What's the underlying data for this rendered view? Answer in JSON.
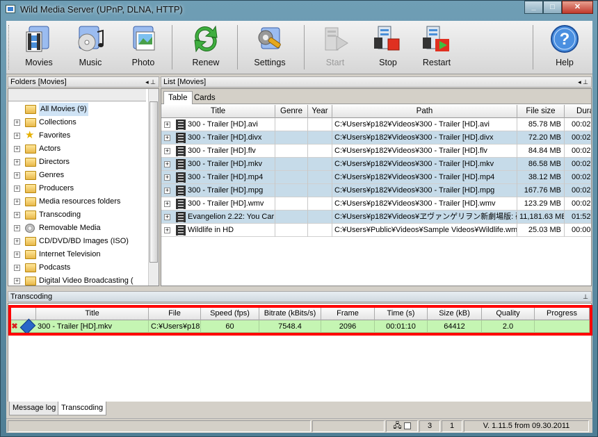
{
  "window": {
    "title": "Wild Media Server (UPnP, DLNA, HTTP)"
  },
  "toolbar": {
    "movies": "Movies",
    "music": "Music",
    "photo": "Photo",
    "renew": "Renew",
    "settings": "Settings",
    "start": "Start",
    "stop": "Stop",
    "restart": "Restart",
    "help": "Help"
  },
  "folders": {
    "header": "Folders [Movies]",
    "items": [
      "All Movies (9)",
      "Collections",
      "Favorites",
      "Actors",
      "Directors",
      "Genres",
      "Producers",
      "Media resources folders",
      "Transcoding",
      "Removable Media",
      "CD/DVD/BD Images (ISO)",
      "Internet Television",
      "Podcasts",
      "Digital Video Broadcasting ("
    ]
  },
  "list": {
    "header": "List [Movies]",
    "tabs": [
      "Table",
      "Cards"
    ],
    "columns": [
      "Title",
      "Genre",
      "Year",
      "Path",
      "File size",
      "Dura"
    ],
    "rows": [
      {
        "title": "300 - Trailer [HD].avi",
        "path": "C:¥Users¥p182¥Videos¥300 - Trailer [HD].avi",
        "size": "85.78 MB",
        "dur": "00:02:"
      },
      {
        "title": "300 - Trailer [HD].divx",
        "path": "C:¥Users¥p182¥Videos¥300 - Trailer [HD].divx",
        "size": "72.20 MB",
        "dur": "00:02:"
      },
      {
        "title": "300 - Trailer [HD].flv",
        "path": "C:¥Users¥p182¥Videos¥300 - Trailer [HD].flv",
        "size": "84.84 MB",
        "dur": "00:02:"
      },
      {
        "title": "300 - Trailer [HD].mkv",
        "path": "C:¥Users¥p182¥Videos¥300 - Trailer [HD].mkv",
        "size": "86.58 MB",
        "dur": "00:02:"
      },
      {
        "title": "300 - Trailer [HD].mp4",
        "path": "C:¥Users¥p182¥Videos¥300 - Trailer [HD].mp4",
        "size": "38.12 MB",
        "dur": "00:02:"
      },
      {
        "title": "300 - Trailer [HD].mpg",
        "path": "C:¥Users¥p182¥Videos¥300 - Trailer [HD].mpg",
        "size": "167.76 MB",
        "dur": "00:02:"
      },
      {
        "title": "300 - Trailer [HD].wmv",
        "path": "C:¥Users¥p182¥Videos¥300 - Trailer [HD].wmv",
        "size": "123.29 MB",
        "dur": "00:02:"
      },
      {
        "title": "Evangelion 2.22: You Car",
        "path": "C:¥Users¥p182¥Videos¥ヱヴァンゲリヲン新劇場版: 破.m",
        "size": "11,181.63 MB",
        "dur": "01:52:"
      },
      {
        "title": "Wildlife in HD",
        "path": "C:¥Users¥Public¥Videos¥Sample Videos¥Wildlife.wmv",
        "size": "25.03 MB",
        "dur": "00:00:"
      }
    ]
  },
  "transcoding": {
    "header": "Transcoding",
    "columns": [
      "Title",
      "File",
      "Speed (fps)",
      "Bitrate (kBits/s)",
      "Frame",
      "Time (s)",
      "Size (kB)",
      "Quality",
      "Progress"
    ],
    "row": {
      "title": "300 - Trailer [HD].mkv",
      "file": "C:¥Users¥p18",
      "speed": "60",
      "bitrate": "7548.4",
      "frame": "2096",
      "time": "00:01:10",
      "size": "64412",
      "quality": "2.0",
      "progress": ""
    },
    "bottom_tabs": [
      "Message log",
      "Transcoding"
    ]
  },
  "status": {
    "a": "3",
    "b": "1",
    "version": "V. 1.11.5 from 09.30.2011"
  }
}
